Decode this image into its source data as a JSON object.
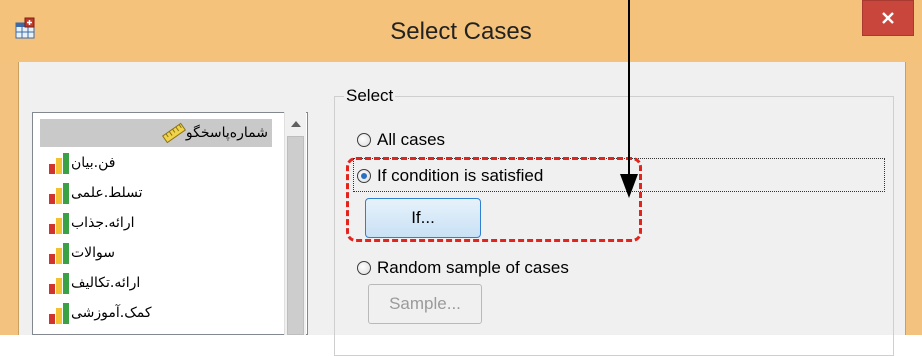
{
  "window": {
    "title": "Select Cases",
    "app_icon": "spss-dataset-icon",
    "close_icon": "close-icon"
  },
  "variables": {
    "items": [
      {
        "label": "شماره‌پاسخگو",
        "icon": "ruler-scale-icon",
        "selected": true
      },
      {
        "label": "فن.بیان",
        "icon": "ordinal-bar-icon",
        "selected": false
      },
      {
        "label": "تسلط.علمی",
        "icon": "ordinal-bar-icon",
        "selected": false
      },
      {
        "label": "ارائه.جذاب",
        "icon": "ordinal-bar-icon",
        "selected": false
      },
      {
        "label": "سوالات",
        "icon": "ordinal-bar-icon",
        "selected": false
      },
      {
        "label": "ارائه.تکالیف",
        "icon": "ordinal-bar-icon",
        "selected": false
      },
      {
        "label": "کمک.آموزشی",
        "icon": "ordinal-bar-icon",
        "selected": false
      }
    ]
  },
  "select_group": {
    "legend": "Select",
    "all_cases": {
      "label": "All cases",
      "checked": false
    },
    "if_condition": {
      "label": "If condition is satisfied",
      "checked": true
    },
    "if_button": "If...",
    "random_sample": {
      "label": "Random sample of cases",
      "checked": false
    },
    "sample_button": "Sample..."
  },
  "colors": {
    "title_bar": "#f4c27b",
    "close_button": "#c9463d",
    "annotation": "#e3231c",
    "selection": "#c9c9c9",
    "button_border_focus": "#2f7fd3"
  }
}
